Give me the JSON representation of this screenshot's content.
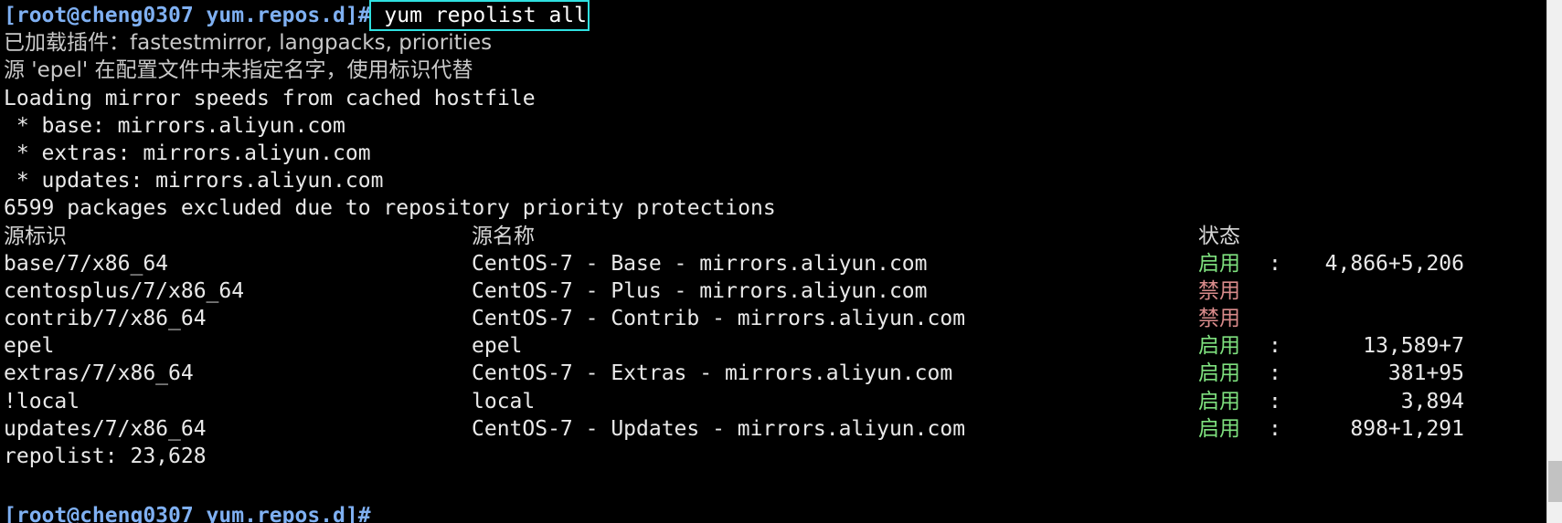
{
  "terminal": {
    "background": "#000000",
    "foreground": "#e8e8e8",
    "prompt_color": "#7fb0f2",
    "selection_outline_color": "#2fe0e0",
    "enabled_color": "#7ee07e",
    "disabled_color": "#d98b8b"
  },
  "command_line": {
    "prompt": "[root@cheng0307 yum.repos.d]#",
    "command": " yum repolist all",
    "selected": true
  },
  "output": {
    "plugins_line": "已加载插件：fastestmirror, langpacks, priorities",
    "repo_name_warning": "源 'epel' 在配置文件中未指定名字，使用标识代替",
    "loading_line": "Loading mirror speeds from cached hostfile",
    "mirrors": [
      " * base: mirrors.aliyun.com",
      " * extras: mirrors.aliyun.com",
      " * updates: mirrors.aliyun.com"
    ],
    "excluded_line": "6599 packages excluded due to repository priority protections",
    "summary_line": "repolist: 23,628"
  },
  "table": {
    "headers": {
      "repo_id": "源标识",
      "repo_name": "源名称",
      "status": "状态"
    },
    "rows": [
      {
        "repo_id": "base/7/x86_64",
        "repo_name": "CentOS-7 - Base - mirrors.aliyun.com",
        "status_label": "启用",
        "status_colon": ":",
        "count": "4,866+5,206",
        "enabled": true
      },
      {
        "repo_id": "centosplus/7/x86_64",
        "repo_name": "CentOS-7 - Plus - mirrors.aliyun.com",
        "status_label": "禁用",
        "status_colon": "",
        "count": "",
        "enabled": false
      },
      {
        "repo_id": "contrib/7/x86_64",
        "repo_name": "CentOS-7 - Contrib - mirrors.aliyun.com",
        "status_label": "禁用",
        "status_colon": "",
        "count": "",
        "enabled": false
      },
      {
        "repo_id": "epel",
        "repo_name": "epel",
        "status_label": "启用",
        "status_colon": ":",
        "count": "13,589+7",
        "enabled": true
      },
      {
        "repo_id": "extras/7/x86_64",
        "repo_name": "CentOS-7 - Extras - mirrors.aliyun.com",
        "status_label": "启用",
        "status_colon": ":",
        "count": "381+95",
        "enabled": true
      },
      {
        "repo_id": "!local",
        "repo_name": "local",
        "status_label": "启用",
        "status_colon": ":",
        "count": "3,894",
        "enabled": true
      },
      {
        "repo_id": "updates/7/x86_64",
        "repo_name": "CentOS-7 - Updates - mirrors.aliyun.com",
        "status_label": "启用",
        "status_colon": ":",
        "count": "898+1,291",
        "enabled": true
      }
    ]
  },
  "next_prompt": {
    "text": "[root@cheng0307 yum.repos.d]#"
  },
  "scrollbar": {
    "orientation": "vertical",
    "position": "right"
  }
}
